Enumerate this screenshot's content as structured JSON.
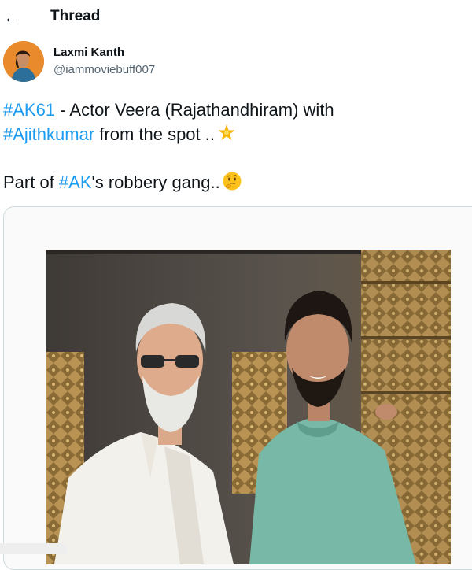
{
  "header": {
    "title": "Thread",
    "back_icon": "back-arrow-icon"
  },
  "author": {
    "name": "Laxmi Kanth",
    "handle": "@iammoviebuff007"
  },
  "tweet": {
    "line1": {
      "hashtag": "#AK61",
      "text": " - Actor Veera (Rajathandhiram) with"
    },
    "line2": {
      "hashtag": "#Ajithkumar",
      "text": " from the spot ..",
      "emoji": "star-emoji-icon"
    },
    "line3": {
      "prefix": "Part of ",
      "hashtag": "#AK",
      "text": "'s robbery gang..",
      "emoji": "thinking-face-emoji-icon"
    }
  },
  "colors": {
    "accent": "#1d9bf0",
    "text": "#0f1419",
    "secondary": "#536471",
    "border": "#cfd9de"
  }
}
